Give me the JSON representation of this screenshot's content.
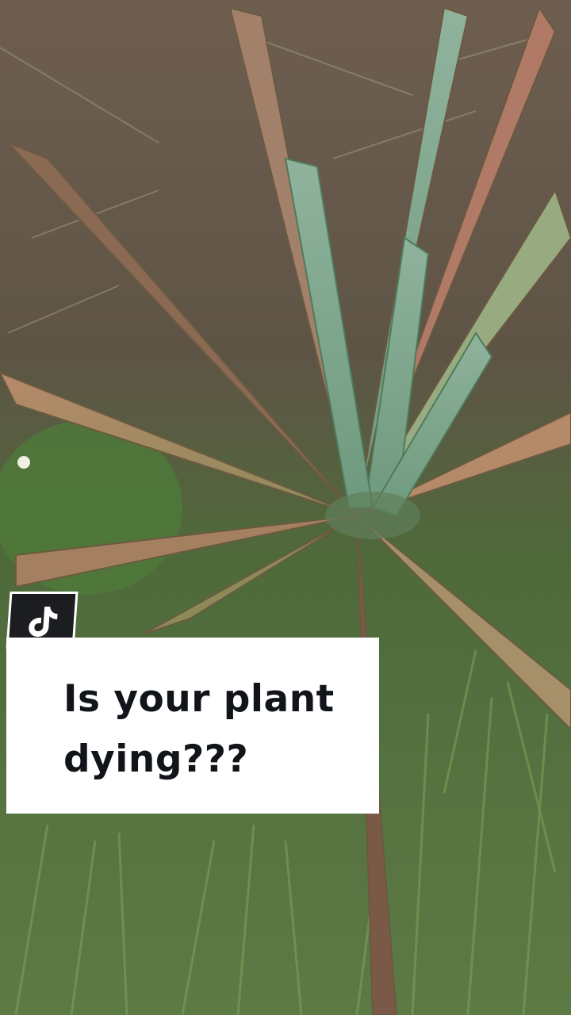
{
  "caption": {
    "text_line1": "Is your plant",
    "text_line2": "dying???"
  },
  "badge": {
    "icon": "tiktok-logo-icon"
  },
  "colors": {
    "caption_bg": "#ffffff",
    "caption_text": "#111418",
    "badge_bg": "#1c1d20"
  }
}
